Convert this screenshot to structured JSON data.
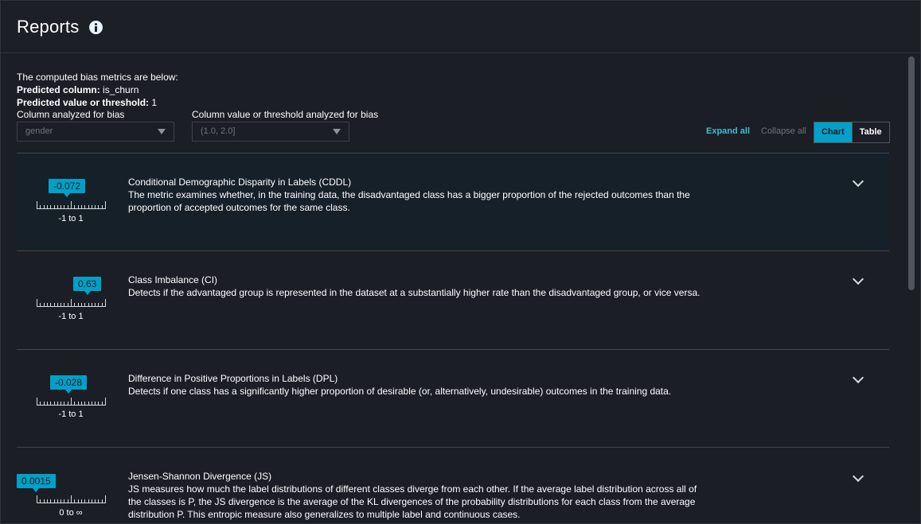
{
  "header": {
    "title": "Reports"
  },
  "summary": {
    "intro": "The computed bias metrics are below:",
    "predicted_column_label": "Predicted column:",
    "predicted_column_value": "is_churn",
    "predicted_value_label": "Predicted value or threshold:",
    "predicted_value_value": "1"
  },
  "filters": {
    "column_label": "Column analyzed for bias",
    "column_value": "gender",
    "threshold_label": "Column value or threshold analyzed for bias",
    "threshold_value": "(1.0, 2.0]"
  },
  "actions": {
    "expand_all": "Expand all",
    "collapse_all": "Collapse all",
    "view_chart": "Chart",
    "view_table": "Table",
    "active_view": "Chart"
  },
  "colors": {
    "accent": "#00a1c9",
    "background": "#1b1e25",
    "highlight_row": "#162029",
    "link": "#44b9d6"
  },
  "metrics": [
    {
      "title": "Conditional Demographic Disparity in Labels (CDDL)",
      "description": "The metric examines whether, in the training data, the disadvantaged class has a bigger proportion of the rejected outcomes than the proportion of accepted outcomes for the same class.",
      "value": "-0.072",
      "value_num": -0.072,
      "range": "-1 to 1",
      "range_min": -1,
      "range_max": 1
    },
    {
      "title": "Class Imbalance (CI)",
      "description": "Detects if the advantaged group is represented in the dataset at a substantially higher rate than the disadvantaged group, or vice versa.",
      "value": "0.63",
      "value_num": 0.63,
      "range": "-1 to 1",
      "range_min": -1,
      "range_max": 1
    },
    {
      "title": "Difference in Positive Proportions in Labels (DPL)",
      "description": "Detects if one class has a significantly higher proportion of desirable (or, alternatively, undesirable) outcomes in the training data.",
      "value": "-0.028",
      "value_num": -0.028,
      "range": "-1 to 1",
      "range_min": -1,
      "range_max": 1
    },
    {
      "title": "Jensen-Shannon Divergence (JS)",
      "description": "JS measures how much the label distributions of different classes diverge from each other. If the average label distribution across all of the classes is P, the JS divergence is the average of the KL divergences of the probability distributions for each class from the average distribution P. This entropic measure also generalizes to multiple label and continuous cases.",
      "value": "0.0015",
      "value_num": 0.0015,
      "range": "0 to ∞",
      "range_min": 0,
      "range_max": null
    }
  ]
}
